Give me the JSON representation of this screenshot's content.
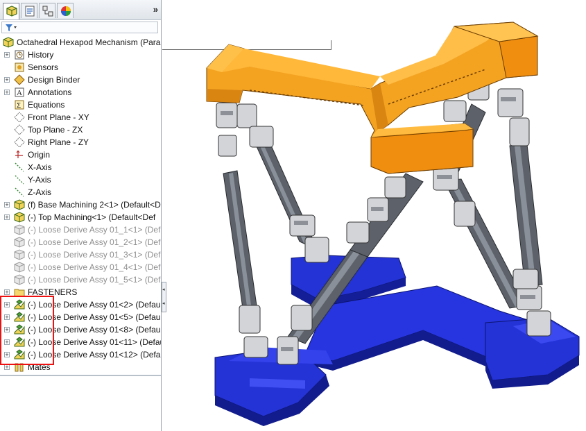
{
  "panel": {
    "tabs": [
      {
        "name": "feature-manager",
        "icon": "feature-tree-icon"
      },
      {
        "name": "property-manager",
        "icon": "property-manager-icon"
      },
      {
        "name": "configuration-manager",
        "icon": "configuration-manager-icon"
      },
      {
        "name": "display-manager",
        "icon": "display-manager-icon"
      }
    ],
    "expand_glyph": "»",
    "filter_icon": "funnel-icon"
  },
  "tree": {
    "root": "Octahedral Hexapod Mechanism (Paral",
    "items": [
      {
        "label": "History",
        "icon": "history-icon",
        "expand": true,
        "indent": 1,
        "gray": false
      },
      {
        "label": "Sensors",
        "icon": "sensors-icon",
        "expand": false,
        "indent": 1,
        "gray": false
      },
      {
        "label": "Design Binder",
        "icon": "design-binder-icon",
        "expand": true,
        "indent": 1,
        "gray": false
      },
      {
        "label": "Annotations",
        "icon": "annotations-icon",
        "expand": true,
        "indent": 1,
        "gray": false
      },
      {
        "label": "Equations",
        "icon": "equations-icon",
        "expand": false,
        "indent": 1,
        "gray": false
      },
      {
        "label": "Front Plane - XY",
        "icon": "plane-icon",
        "expand": false,
        "indent": 1,
        "gray": false
      },
      {
        "label": "Top Plane - ZX",
        "icon": "plane-icon",
        "expand": false,
        "indent": 1,
        "gray": false
      },
      {
        "label": "Right Plane - ZY",
        "icon": "plane-icon",
        "expand": false,
        "indent": 1,
        "gray": false
      },
      {
        "label": "Origin",
        "icon": "origin-icon",
        "expand": false,
        "indent": 1,
        "gray": false
      },
      {
        "label": "X-Axis",
        "icon": "axis-icon",
        "expand": false,
        "indent": 1,
        "gray": false
      },
      {
        "label": "Y-Axis",
        "icon": "axis-icon",
        "expand": false,
        "indent": 1,
        "gray": false
      },
      {
        "label": "Z-Axis",
        "icon": "axis-icon",
        "expand": false,
        "indent": 1,
        "gray": false
      },
      {
        "label": "(f) Base Machining 2<1> (Default<D",
        "icon": "part-icon",
        "expand": true,
        "indent": 1,
        "gray": false
      },
      {
        "label": "(-) Top Machining<1> (Default<Def",
        "icon": "part-icon",
        "expand": true,
        "indent": 1,
        "gray": false
      },
      {
        "label": "(-) Loose Derive Assy 01_1<1> (Def",
        "icon": "part-gray-icon",
        "expand": false,
        "indent": 1,
        "gray": true
      },
      {
        "label": "(-) Loose Derive Assy 01_2<1> (Def",
        "icon": "part-gray-icon",
        "expand": false,
        "indent": 1,
        "gray": true
      },
      {
        "label": "(-) Loose Derive Assy 01_3<1> (Def",
        "icon": "part-gray-icon",
        "expand": false,
        "indent": 1,
        "gray": true
      },
      {
        "label": "(-) Loose Derive Assy 01_4<1> (Def",
        "icon": "part-gray-icon",
        "expand": false,
        "indent": 1,
        "gray": true
      },
      {
        "label": "(-) Loose Derive Assy 01_5<1> (Def",
        "icon": "part-gray-icon",
        "expand": false,
        "indent": 1,
        "gray": true
      },
      {
        "label": "FASTENERS",
        "icon": "folder-icon",
        "expand": true,
        "indent": 1,
        "gray": false
      },
      {
        "label": "(-) Loose Derive Assy 01<2> (Defaul",
        "icon": "subassembly-icon",
        "expand": true,
        "indent": 1,
        "gray": false
      },
      {
        "label": "(-) Loose Derive Assy 01<5> (Defaul",
        "icon": "subassembly-icon",
        "expand": true,
        "indent": 1,
        "gray": false
      },
      {
        "label": "(-) Loose Derive Assy 01<8> (Defaul",
        "icon": "subassembly-icon",
        "expand": true,
        "indent": 1,
        "gray": false
      },
      {
        "label": "(-) Loose Derive Assy 01<11> (Defau",
        "icon": "subassembly-icon",
        "expand": true,
        "indent": 1,
        "gray": false
      },
      {
        "label": "(-) Loose Derive Assy 01<12> (Defau",
        "icon": "subassembly-icon",
        "expand": true,
        "indent": 1,
        "gray": false
      },
      {
        "label": "Mates",
        "icon": "mates-icon",
        "expand": true,
        "indent": 1,
        "gray": false
      }
    ]
  },
  "colors": {
    "top_plate": "#f0a020",
    "base": "#1f2fd0",
    "strut": "#5c6068",
    "joint": "#c8c8c8",
    "highlight_box": "#e11111"
  },
  "viewport": {
    "icon": "hexapod-model"
  }
}
